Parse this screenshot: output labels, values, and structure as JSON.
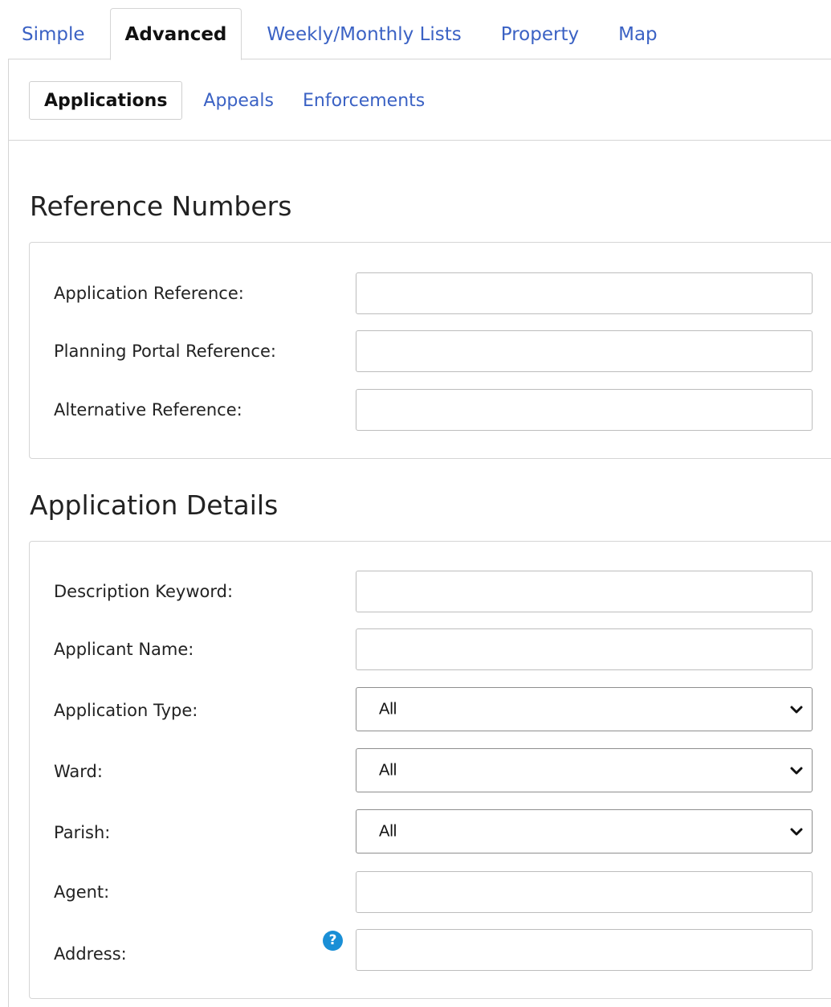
{
  "top_tabs": [
    {
      "label": "Simple",
      "active": false
    },
    {
      "label": "Advanced",
      "active": true
    },
    {
      "label": "Weekly/Monthly Lists",
      "active": false
    },
    {
      "label": "Property",
      "active": false
    },
    {
      "label": "Map",
      "active": false
    }
  ],
  "sub_tabs": [
    {
      "label": "Applications",
      "active": true
    },
    {
      "label": "Appeals",
      "active": false
    },
    {
      "label": "Enforcements",
      "active": false
    }
  ],
  "reference_numbers": {
    "heading": "Reference Numbers",
    "fields": {
      "application_reference": {
        "label": "Application Reference:",
        "value": ""
      },
      "planning_portal_reference": {
        "label": "Planning Portal Reference:",
        "value": ""
      },
      "alternative_reference": {
        "label": "Alternative Reference:",
        "value": ""
      }
    }
  },
  "application_details": {
    "heading": "Application Details",
    "fields": {
      "description_keyword": {
        "label": "Description Keyword:",
        "value": ""
      },
      "applicant_name": {
        "label": "Applicant Name:",
        "value": ""
      },
      "application_type": {
        "label": "Application Type:",
        "selected": "All"
      },
      "ward": {
        "label": "Ward:",
        "selected": "All"
      },
      "parish": {
        "label": "Parish:",
        "selected": "All"
      },
      "agent": {
        "label": "Agent:",
        "value": ""
      },
      "address": {
        "label": "Address:",
        "value": "",
        "help_icon": "question-circle-icon"
      }
    }
  },
  "colors": {
    "link": "#3b62c4",
    "border": "#d5d5d5",
    "help_icon": "#1a8fd6"
  }
}
